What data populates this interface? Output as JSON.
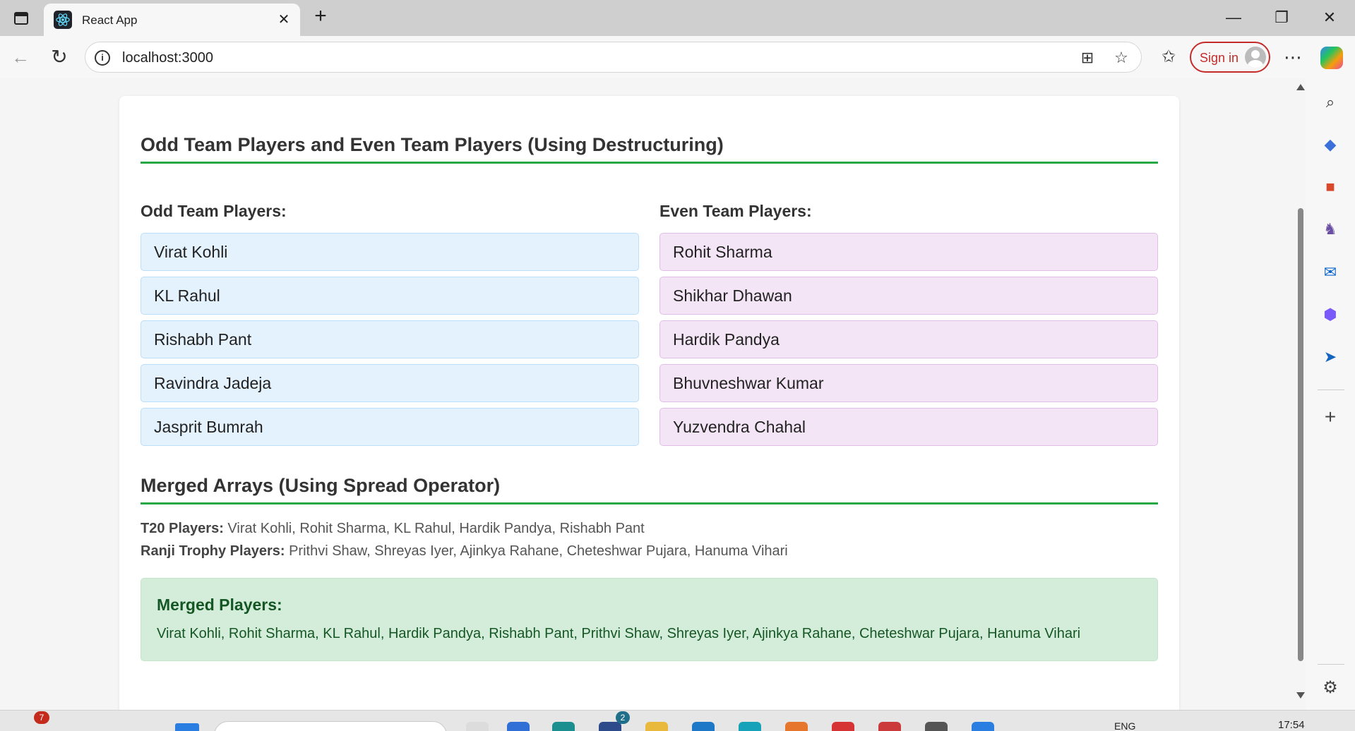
{
  "browser": {
    "tab_title": "React App",
    "url": "localhost:3000",
    "signin_label": "Sign in"
  },
  "page": {
    "section1_title": "Odd Team Players and Even Team Players (Using Destructuring)",
    "odd_title": "Odd Team Players:",
    "even_title": "Even Team Players:",
    "odd_players": [
      "Virat Kohli",
      "KL Rahul",
      "Rishabh Pant",
      "Ravindra Jadeja",
      "Jasprit Bumrah"
    ],
    "even_players": [
      "Rohit Sharma",
      "Shikhar Dhawan",
      "Hardik Pandya",
      "Bhuvneshwar Kumar",
      "Yuzvendra Chahal"
    ],
    "section2_title": "Merged Arrays (Using Spread Operator)",
    "t20_label": "T20 Players:",
    "t20_players": "Virat Kohli, Rohit Sharma, KL Rahul, Hardik Pandya, Rishabh Pant",
    "ranji_label": "Ranji Trophy Players:",
    "ranji_players": "Prithvi Shaw, Shreyas Iyer, Ajinkya Rahane, Cheteshwar Pujara, Hanuma Vihari",
    "merged_title": "Merged Players:",
    "merged_players": "Virat Kohli, Rohit Sharma, KL Rahul, Hardik Pandya, Rishabh Pant, Prithvi Shaw, Shreyas Iyer, Ajinkya Rahane, Cheteshwar Pujara, Hanuma Vihari"
  },
  "taskbar": {
    "notification_count": "7",
    "app_badge_count": "2",
    "language": "ENG",
    "time": "17:54"
  },
  "icons": {
    "tab_toggle": "vertical-tabs-icon",
    "favicon": "react-icon",
    "close": "close-icon",
    "new_tab": "plus-icon",
    "back": "arrow-left-icon",
    "reload": "reload-icon",
    "info": "info-icon",
    "apps": "apps-icon",
    "favorite": "star-icon",
    "favorites": "favorites-icon",
    "more": "more-icon",
    "copilot": "copilot-icon",
    "sidebar": [
      "search-icon",
      "tag-icon",
      "tools-icon",
      "games-icon",
      "outlook-icon",
      "m365-icon",
      "send-icon",
      "plus-icon",
      "gear-icon"
    ]
  },
  "colors": {
    "section_underline": "#28a745",
    "odd_bg": "#e3f2fd",
    "even_bg": "#f3e5f5",
    "merged_bg": "#d4edda",
    "merged_text": "#155724",
    "signin": "#c42b2b"
  }
}
